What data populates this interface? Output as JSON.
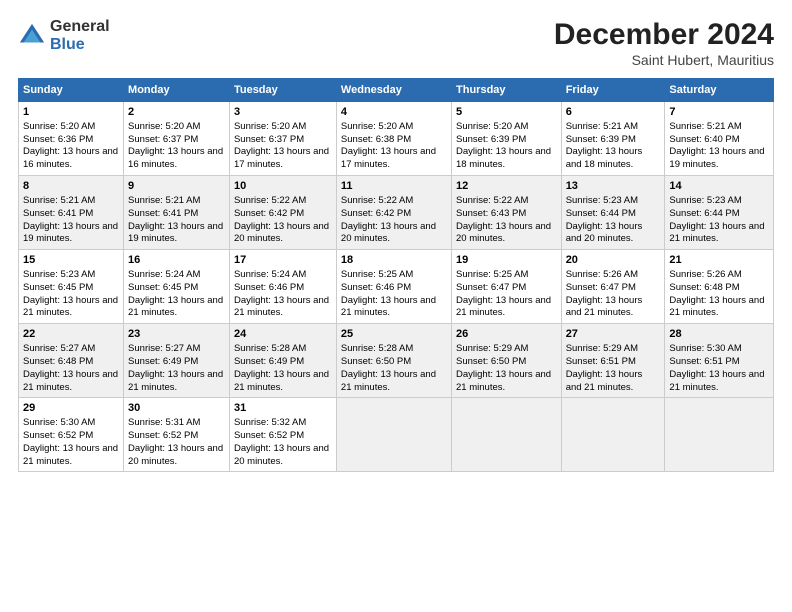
{
  "logo": {
    "general": "General",
    "blue": "Blue"
  },
  "title": "December 2024",
  "subtitle": "Saint Hubert, Mauritius",
  "days_of_week": [
    "Sunday",
    "Monday",
    "Tuesday",
    "Wednesday",
    "Thursday",
    "Friday",
    "Saturday"
  ],
  "weeks": [
    [
      {
        "day": "1",
        "rise": "5:20 AM",
        "set": "6:36 PM",
        "daylight": "13 hours and 16 minutes."
      },
      {
        "day": "2",
        "rise": "5:20 AM",
        "set": "6:37 PM",
        "daylight": "13 hours and 16 minutes."
      },
      {
        "day": "3",
        "rise": "5:20 AM",
        "set": "6:37 PM",
        "daylight": "13 hours and 17 minutes."
      },
      {
        "day": "4",
        "rise": "5:20 AM",
        "set": "6:38 PM",
        "daylight": "13 hours and 17 minutes."
      },
      {
        "day": "5",
        "rise": "5:20 AM",
        "set": "6:39 PM",
        "daylight": "13 hours and 18 minutes."
      },
      {
        "day": "6",
        "rise": "5:21 AM",
        "set": "6:39 PM",
        "daylight": "13 hours and 18 minutes."
      },
      {
        "day": "7",
        "rise": "5:21 AM",
        "set": "6:40 PM",
        "daylight": "13 hours and 19 minutes."
      }
    ],
    [
      {
        "day": "8",
        "rise": "5:21 AM",
        "set": "6:41 PM",
        "daylight": "13 hours and 19 minutes."
      },
      {
        "day": "9",
        "rise": "5:21 AM",
        "set": "6:41 PM",
        "daylight": "13 hours and 19 minutes."
      },
      {
        "day": "10",
        "rise": "5:22 AM",
        "set": "6:42 PM",
        "daylight": "13 hours and 20 minutes."
      },
      {
        "day": "11",
        "rise": "5:22 AM",
        "set": "6:42 PM",
        "daylight": "13 hours and 20 minutes."
      },
      {
        "day": "12",
        "rise": "5:22 AM",
        "set": "6:43 PM",
        "daylight": "13 hours and 20 minutes."
      },
      {
        "day": "13",
        "rise": "5:23 AM",
        "set": "6:44 PM",
        "daylight": "13 hours and 20 minutes."
      },
      {
        "day": "14",
        "rise": "5:23 AM",
        "set": "6:44 PM",
        "daylight": "13 hours and 21 minutes."
      }
    ],
    [
      {
        "day": "15",
        "rise": "5:23 AM",
        "set": "6:45 PM",
        "daylight": "13 hours and 21 minutes."
      },
      {
        "day": "16",
        "rise": "5:24 AM",
        "set": "6:45 PM",
        "daylight": "13 hours and 21 minutes."
      },
      {
        "day": "17",
        "rise": "5:24 AM",
        "set": "6:46 PM",
        "daylight": "13 hours and 21 minutes."
      },
      {
        "day": "18",
        "rise": "5:25 AM",
        "set": "6:46 PM",
        "daylight": "13 hours and 21 minutes."
      },
      {
        "day": "19",
        "rise": "5:25 AM",
        "set": "6:47 PM",
        "daylight": "13 hours and 21 minutes."
      },
      {
        "day": "20",
        "rise": "5:26 AM",
        "set": "6:47 PM",
        "daylight": "13 hours and 21 minutes."
      },
      {
        "day": "21",
        "rise": "5:26 AM",
        "set": "6:48 PM",
        "daylight": "13 hours and 21 minutes."
      }
    ],
    [
      {
        "day": "22",
        "rise": "5:27 AM",
        "set": "6:48 PM",
        "daylight": "13 hours and 21 minutes."
      },
      {
        "day": "23",
        "rise": "5:27 AM",
        "set": "6:49 PM",
        "daylight": "13 hours and 21 minutes."
      },
      {
        "day": "24",
        "rise": "5:28 AM",
        "set": "6:49 PM",
        "daylight": "13 hours and 21 minutes."
      },
      {
        "day": "25",
        "rise": "5:28 AM",
        "set": "6:50 PM",
        "daylight": "13 hours and 21 minutes."
      },
      {
        "day": "26",
        "rise": "5:29 AM",
        "set": "6:50 PM",
        "daylight": "13 hours and 21 minutes."
      },
      {
        "day": "27",
        "rise": "5:29 AM",
        "set": "6:51 PM",
        "daylight": "13 hours and 21 minutes."
      },
      {
        "day": "28",
        "rise": "5:30 AM",
        "set": "6:51 PM",
        "daylight": "13 hours and 21 minutes."
      }
    ],
    [
      {
        "day": "29",
        "rise": "5:30 AM",
        "set": "6:52 PM",
        "daylight": "13 hours and 21 minutes."
      },
      {
        "day": "30",
        "rise": "5:31 AM",
        "set": "6:52 PM",
        "daylight": "13 hours and 20 minutes."
      },
      {
        "day": "31",
        "rise": "5:32 AM",
        "set": "6:52 PM",
        "daylight": "13 hours and 20 minutes."
      },
      null,
      null,
      null,
      null
    ]
  ]
}
